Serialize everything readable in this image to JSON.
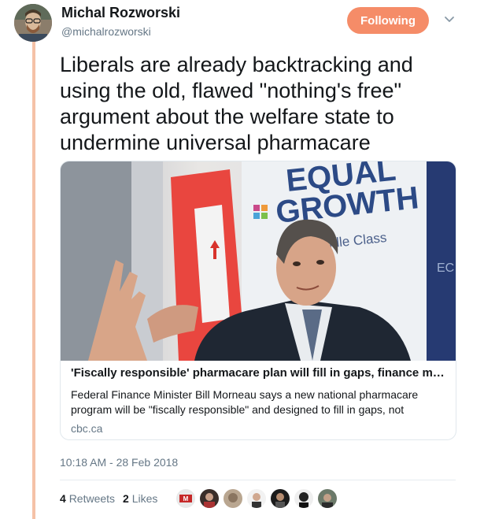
{
  "author": {
    "name": "Michal Rozworski",
    "handle": "@michalrozworski",
    "avatar_icon": "profile-photo"
  },
  "follow_button": {
    "label": "Following",
    "color": "#f58c68"
  },
  "menu_icon": "chevron-down-icon",
  "tweet": {
    "text": "Liberals are already backtracking and using the old, flawed \"nothing's free\" argument about the welfare state to undermine universal pharmacare"
  },
  "card": {
    "image_text": {
      "line1": "EQUAL",
      "line2": "GROWTH",
      "line3": "Middle Class",
      "line4": "EC"
    },
    "title": "'Fiscally responsible' pharmacare plan will fill in gaps, finance minist...",
    "description": "Federal Finance Minister Bill Morneau says a new national pharmacare program will be \"fiscally responsible\" and designed to fill in gaps, not",
    "domain": "cbc.ca"
  },
  "timestamp": "10:18 AM - 28 Feb 2018",
  "stats": {
    "retweets_count": "4",
    "retweets_label": "Retweets",
    "likes_count": "2",
    "likes_label": "Likes"
  },
  "liker_avatars": [
    "avatar-1",
    "avatar-2",
    "avatar-3",
    "avatar-4",
    "avatar-5",
    "avatar-6",
    "avatar-7"
  ],
  "thread_color": "#f5c2a7"
}
